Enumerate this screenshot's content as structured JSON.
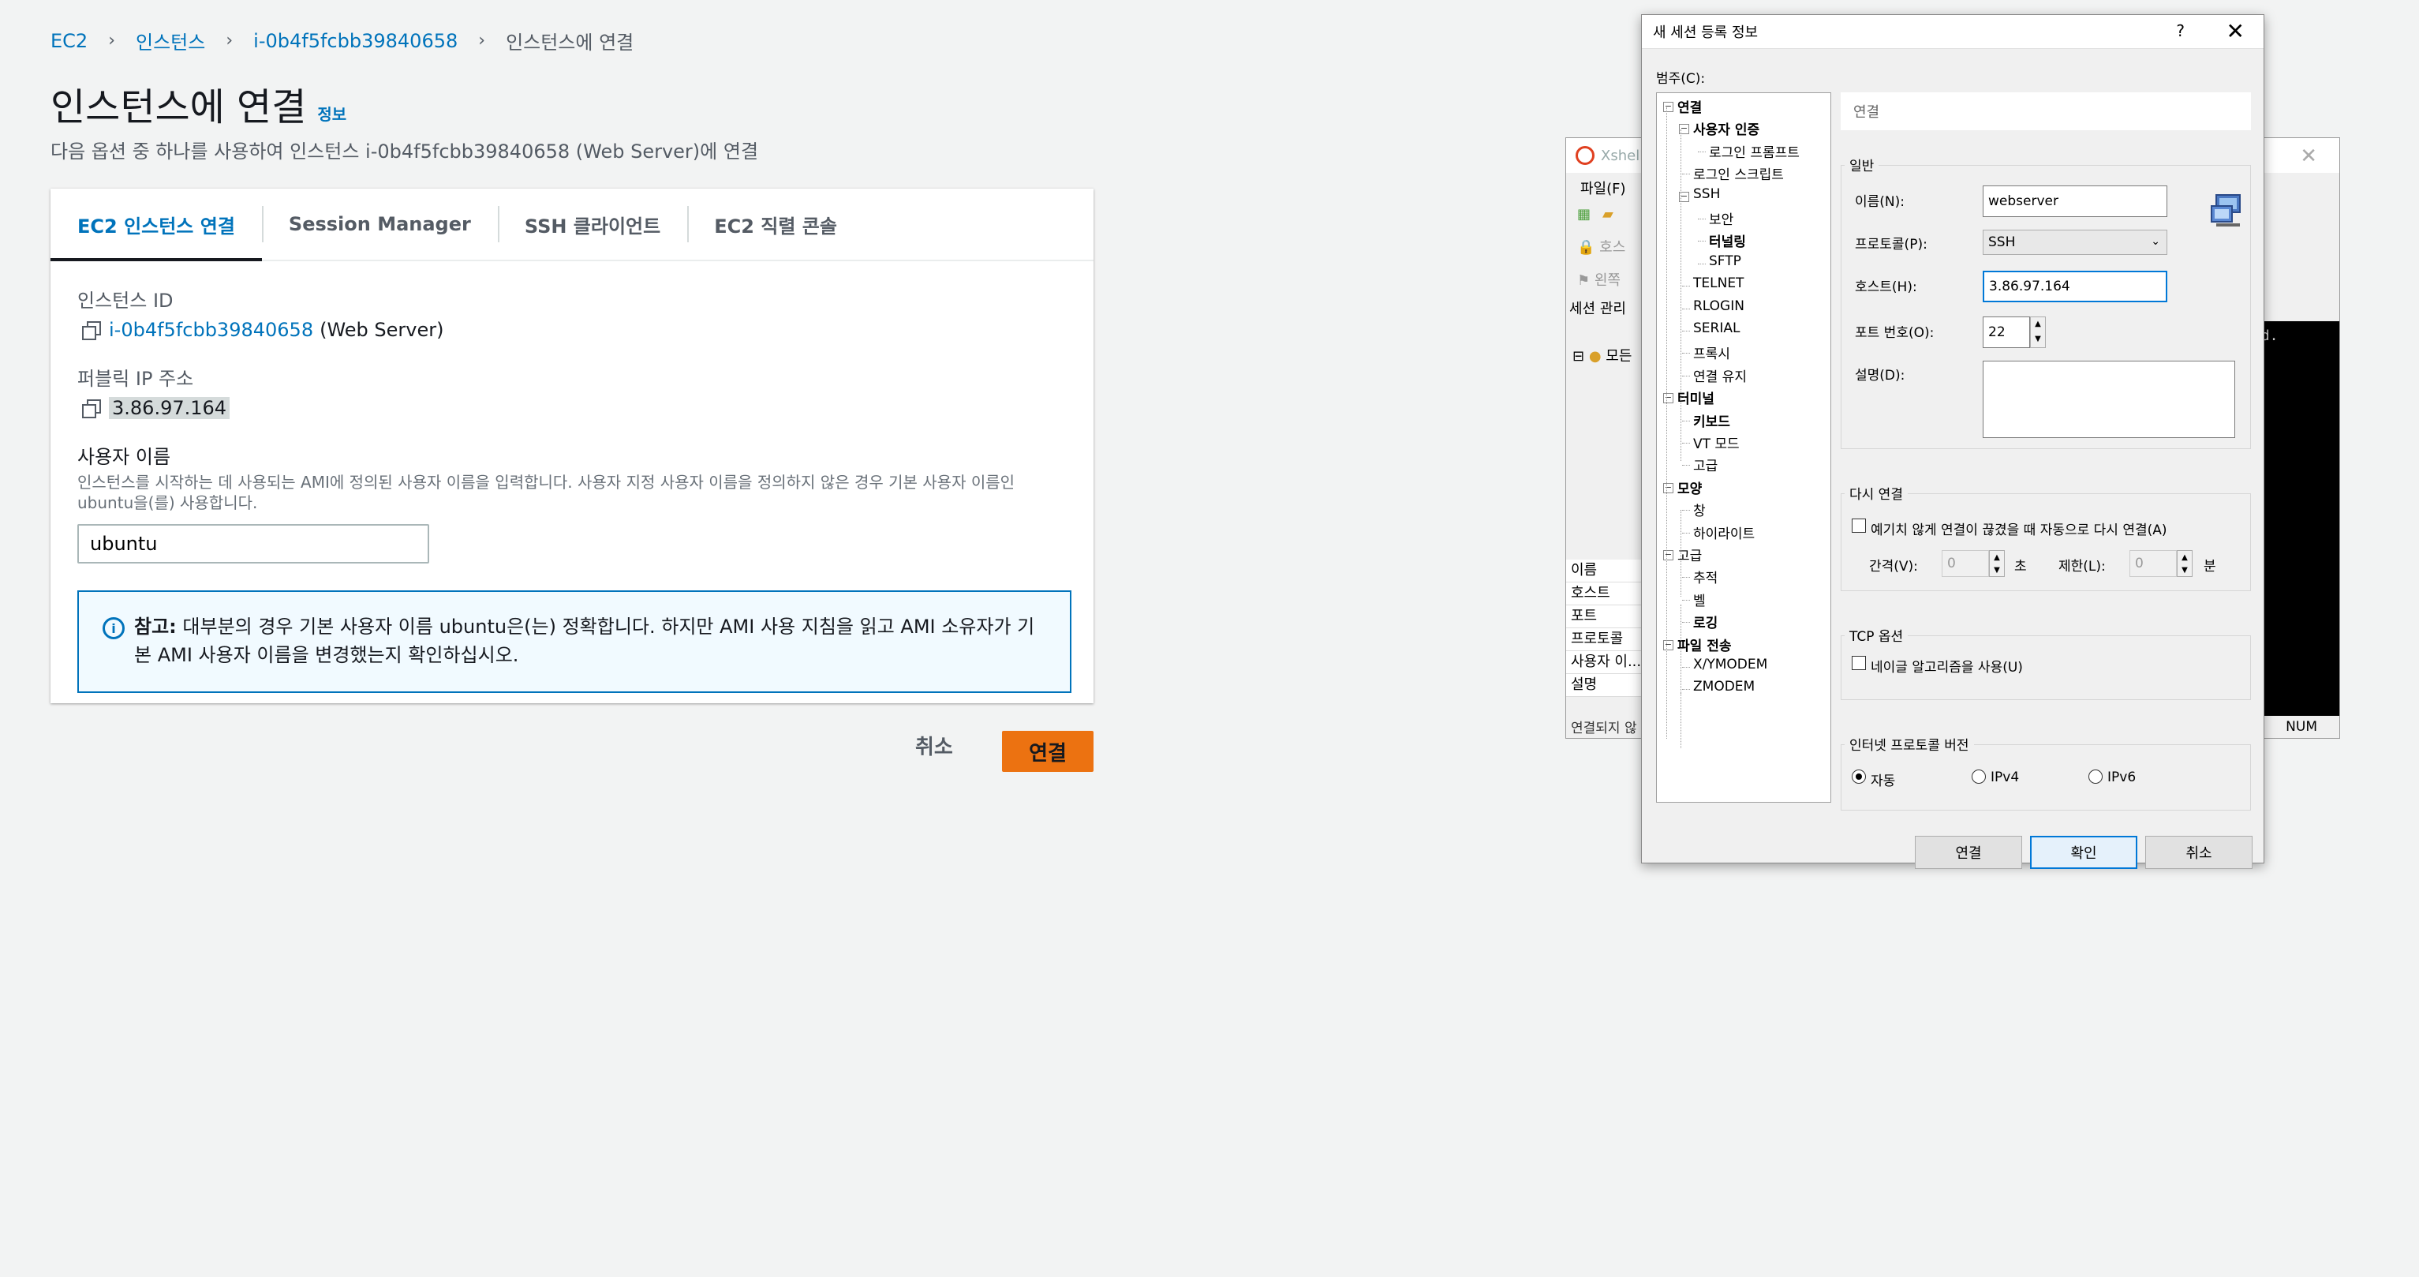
{
  "breadcrumb": {
    "items": [
      "EC2",
      "인스턴스",
      "i-0b4f5fcbb39840658"
    ],
    "current": "인스턴스에 연결"
  },
  "page": {
    "title": "인스턴스에 연결",
    "info_link": "정보",
    "description": "다음 옵션 중 하나를 사용하여 인스턴스 i-0b4f5fcbb39840658 (Web Server)에 연결"
  },
  "tabs": [
    {
      "label": "EC2 인스턴스 연결",
      "active": true
    },
    {
      "label": "Session Manager",
      "active": false
    },
    {
      "label": "SSH 클라이언트",
      "active": false
    },
    {
      "label": "EC2 직렬 콘솔",
      "active": false
    }
  ],
  "instance": {
    "id_label": "인스턴스 ID",
    "id_value": "i-0b4f5fcbb39840658",
    "name_suffix": "(Web Server)",
    "ip_label": "퍼블릭 IP 주소",
    "ip_value": "3.86.97.164",
    "user_label": "사용자 이름",
    "user_help": "인스턴스를 시작하는 데 사용되는 AMI에 정의된 사용자 이름을 입력합니다. 사용자 지정 사용자 이름을 정의하지 않은 경우 기본 사용자 이름인 ubuntu을(를) 사용합니다.",
    "user_value": "ubuntu"
  },
  "alert": {
    "prefix": "참고:",
    "text": "대부분의 경우 기본 사용자 이름 ubuntu은(는) 정확합니다. 하지만 AMI 사용 지침을 읽고 AMI 소유자가 기본 AMI 사용자 이름을 변경했는지 확인하십시오."
  },
  "actions": {
    "cancel": "취소",
    "connect": "연결"
  },
  "xshell": {
    "title": "Xshell",
    "menu_file": "파일(F)",
    "host_row": "호스",
    "left_row": "왼쪽",
    "session_manager": "세션 관리",
    "tree_root": "모든",
    "props": [
      "이름",
      "호스트",
      "포트",
      "프로토콜",
      "사용자 이...",
      "설명"
    ],
    "terminal_text": "ed.",
    "status": "연결되지 않",
    "num": "NUM"
  },
  "dialog": {
    "title": "새 세션 등록 정보",
    "help": "?",
    "category_label": "범주(C):",
    "tree": [
      {
        "label": "연결",
        "bold": true,
        "level": 0,
        "box": "−"
      },
      {
        "label": "사용자 인증",
        "bold": true,
        "level": 1,
        "box": "−"
      },
      {
        "label": "로그인 프롬프트",
        "bold": false,
        "level": 2
      },
      {
        "label": "로그인 스크립트",
        "bold": false,
        "level": 1
      },
      {
        "label": "SSH",
        "bold": false,
        "level": 1,
        "box": "−"
      },
      {
        "label": "보안",
        "bold": false,
        "level": 2
      },
      {
        "label": "터널링",
        "bold": true,
        "level": 2
      },
      {
        "label": "SFTP",
        "bold": false,
        "level": 2
      },
      {
        "label": "TELNET",
        "bold": false,
        "level": 1
      },
      {
        "label": "RLOGIN",
        "bold": false,
        "level": 1
      },
      {
        "label": "SERIAL",
        "bold": false,
        "level": 1
      },
      {
        "label": "프록시",
        "bold": false,
        "level": 1
      },
      {
        "label": "연결 유지",
        "bold": false,
        "level": 1
      },
      {
        "label": "터미널",
        "bold": true,
        "level": 0,
        "box": "−"
      },
      {
        "label": "키보드",
        "bold": true,
        "level": 1
      },
      {
        "label": "VT 모드",
        "bold": false,
        "level": 1
      },
      {
        "label": "고급",
        "bold": false,
        "level": 1
      },
      {
        "label": "모양",
        "bold": true,
        "level": 0,
        "box": "−"
      },
      {
        "label": "창",
        "bold": false,
        "level": 1
      },
      {
        "label": "하이라이트",
        "bold": false,
        "level": 1
      },
      {
        "label": "고급",
        "bold": false,
        "level": 0,
        "box": "−"
      },
      {
        "label": "추적",
        "bold": false,
        "level": 1
      },
      {
        "label": "벨",
        "bold": false,
        "level": 1
      },
      {
        "label": "로깅",
        "bold": true,
        "level": 1
      },
      {
        "label": "파일 전송",
        "bold": true,
        "level": 0,
        "box": "−"
      },
      {
        "label": "X/YMODEM",
        "bold": false,
        "level": 1
      },
      {
        "label": "ZMODEM",
        "bold": false,
        "level": 1
      }
    ],
    "section_header": "연결",
    "general": {
      "title": "일반",
      "name_label": "이름(N):",
      "name_value": "webserver",
      "protocol_label": "프로토콜(P):",
      "protocol_value": "SSH",
      "host_label": "호스트(H):",
      "host_value": "3.86.97.164",
      "port_label": "포트 번호(O):",
      "port_value": "22",
      "desc_label": "설명(D):"
    },
    "reconnect": {
      "title": "다시 연결",
      "checkbox": "예기치 않게 연결이 끊겼을 때 자동으로 다시 연결(A)",
      "interval_label": "간격(V):",
      "interval_value": "0",
      "interval_unit": "초",
      "limit_label": "제한(L):",
      "limit_value": "0",
      "limit_unit": "분"
    },
    "tcp": {
      "title": "TCP 옵션",
      "checkbox": "네이글 알고리즘을 사용(U)"
    },
    "ipver": {
      "title": "인터넷 프로토콜 버전",
      "options": [
        "자동",
        "IPv4",
        "IPv6"
      ]
    },
    "buttons": {
      "connect": "연결",
      "ok": "확인",
      "cancel": "취소"
    }
  }
}
